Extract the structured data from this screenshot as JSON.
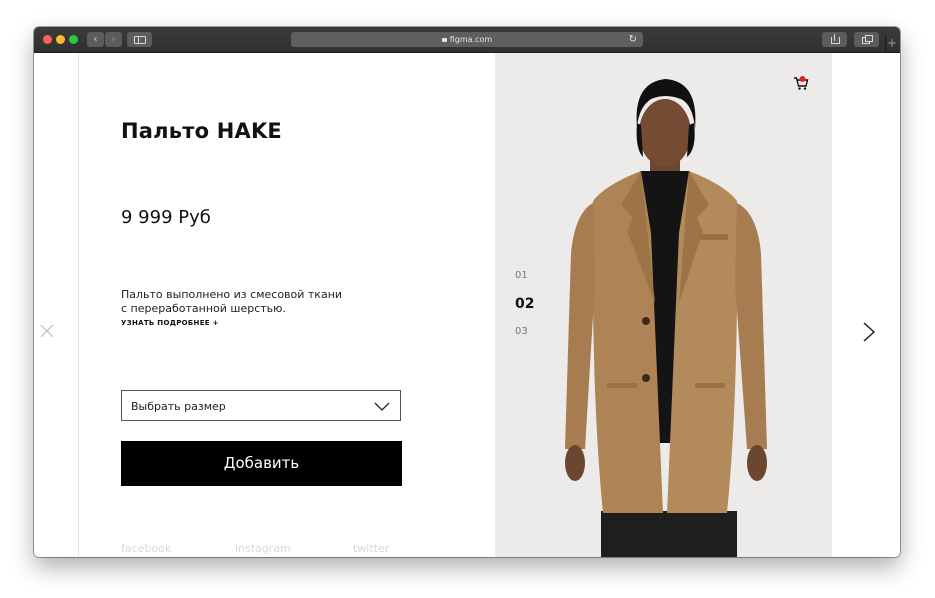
{
  "browser": {
    "url": "figma.com"
  },
  "product": {
    "title": "Пальто HAKE",
    "price": "9 999 Руб",
    "description_line1": "Пальто выполнено из смесовой ткани",
    "description_line2": "с переработанной шерстью.",
    "more_link": "УЗНАТЬ ПОДРОБНЕЕ +",
    "size_select_label": "Выбрать размер",
    "add_button": "Добавить"
  },
  "social": {
    "facebook": "facebook",
    "instagram": "instagram",
    "twitter": "twitter"
  },
  "gallery": {
    "pages": [
      "01",
      "02",
      "03"
    ],
    "active_page": "02"
  },
  "colors": {
    "button_bg": "#000000",
    "photo_bg": "#edebe9",
    "coat": "#b0865a",
    "cart_accent": "#e02424"
  },
  "icons": {
    "close": "close-icon",
    "next": "chevron-right-icon",
    "cart": "shopping-cart-icon",
    "dropdown": "chevron-down-icon"
  }
}
